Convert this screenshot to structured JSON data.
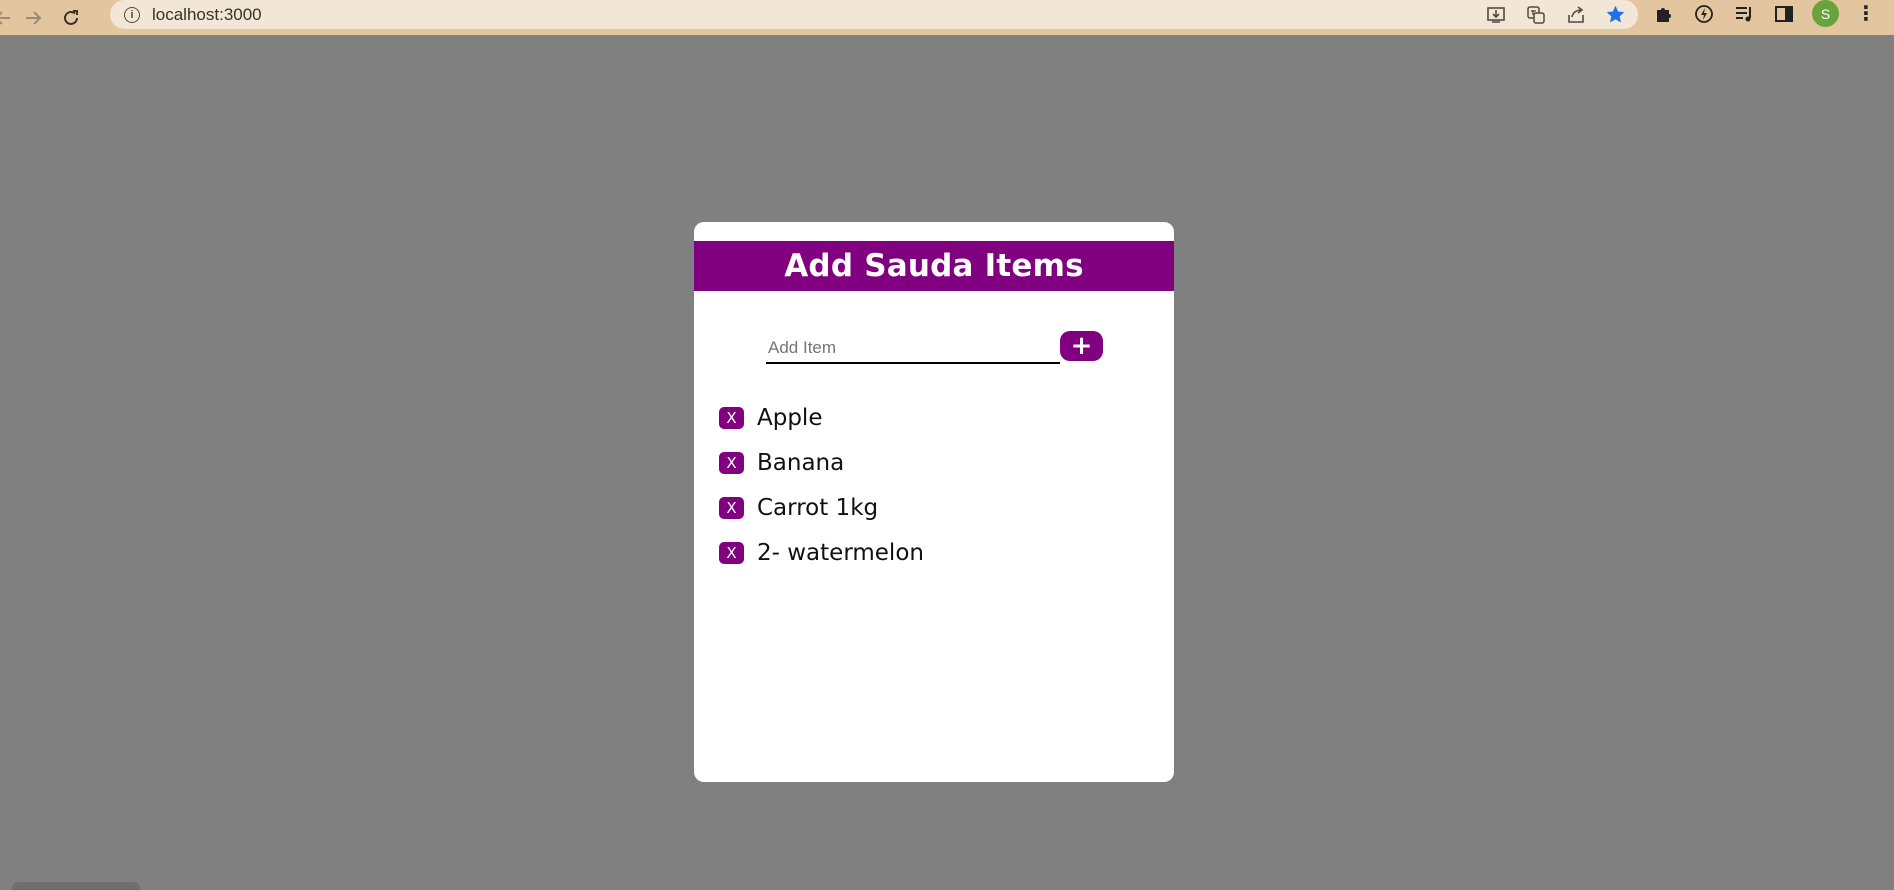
{
  "browser": {
    "url": "localhost:3000",
    "avatar_letter": "S",
    "nav_icons": [
      "back-arrow-icon",
      "forward-arrow-icon",
      "reload-icon"
    ],
    "address_icons": [
      "install-icon",
      "translate-icon",
      "share-icon",
      "bookmark-star-icon"
    ],
    "toolbar_icons": [
      "extensions-puzzle-icon",
      "performance-icon",
      "reading-list-icon",
      "side-panel-icon"
    ]
  },
  "colors": {
    "accent": "#800080",
    "page_background": "#808080",
    "browser_bar": "#e3c6a0",
    "card": "#ffffff"
  },
  "card": {
    "title": "Add Sauda Items",
    "input_placeholder": "Add Item",
    "input_value": "",
    "add_button_label": "+",
    "delete_button_label": "X",
    "items": [
      {
        "label": "Apple"
      },
      {
        "label": "Banana"
      },
      {
        "label": "Carrot 1kg"
      },
      {
        "label": "2- watermelon"
      }
    ]
  }
}
